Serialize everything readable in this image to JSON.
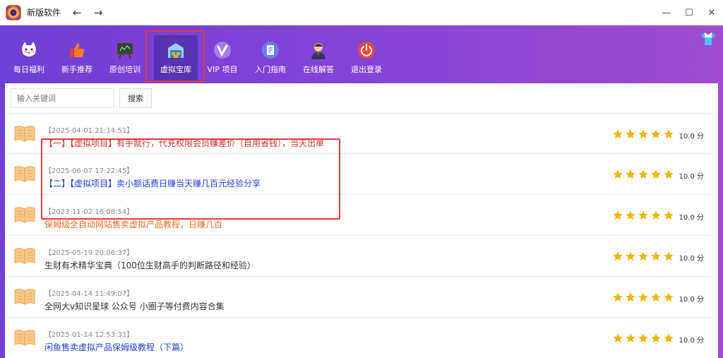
{
  "app": {
    "title": "新版软件"
  },
  "toolbar": {
    "items": [
      {
        "label": "每日福利",
        "icon": "cat-icon"
      },
      {
        "label": "新手推荐",
        "icon": "thumbs-up-icon"
      },
      {
        "label": "原创培训",
        "icon": "blackboard-icon"
      },
      {
        "label": "虚拟宝库",
        "icon": "warehouse-icon"
      },
      {
        "label": "VIP 项目",
        "icon": "vip-icon"
      },
      {
        "label": "入门指南",
        "icon": "document-icon"
      },
      {
        "label": "在线解答",
        "icon": "support-agent-icon"
      },
      {
        "label": "退出登录",
        "icon": "power-icon"
      }
    ],
    "active_index": 3
  },
  "search": {
    "placeholder": "输入关键词",
    "button_label": "搜索"
  },
  "list": {
    "items": [
      {
        "date": "【2025-04-01 21:14:51】",
        "title": "【一】【虚拟项目】有手就行，代充权限会员赚差价（自用省钱），当天出单",
        "title_color": "#d32f2f",
        "rating": 5,
        "score": "10.0 分"
      },
      {
        "date": "【2025-06-07 17:22:45】",
        "title": "【二】【虚拟项目】卖小额话费日赚当天赚几百元经验分享",
        "title_color": "#1e3fd6",
        "rating": 5,
        "score": "10.0 分"
      },
      {
        "date": "【2023-11-02 16:08:54】",
        "title": "保姆级全自动网站售卖虚拟产品教程，日赚几百",
        "title_color": "#f06a22",
        "rating": 5,
        "score": "10.0 分"
      },
      {
        "date": "【2025-05-19 20:06:37】",
        "title": "生财有术精华宝典（100位生财高手的判断路径和经验）",
        "title_color": "#333333",
        "rating": 5,
        "score": "10.0 分"
      },
      {
        "date": "【2025-04-14 11:49:07】",
        "title": "全网大v知识星球 公众号 小圈子等付费内容合集",
        "title_color": "#333333",
        "rating": 5,
        "score": "10.0 分"
      },
      {
        "date": "【2025-01-14 12:53:31】",
        "title": "闲鱼售卖虚拟产品保姆级教程（下篇）",
        "title_color": "#1e3fd6",
        "rating": 5,
        "score": "10.0 分"
      }
    ]
  },
  "colors": {
    "header_start": "#6f3fd6",
    "header_end": "#a04ccd",
    "star": "#f5b400",
    "highlight": "#e53935"
  }
}
